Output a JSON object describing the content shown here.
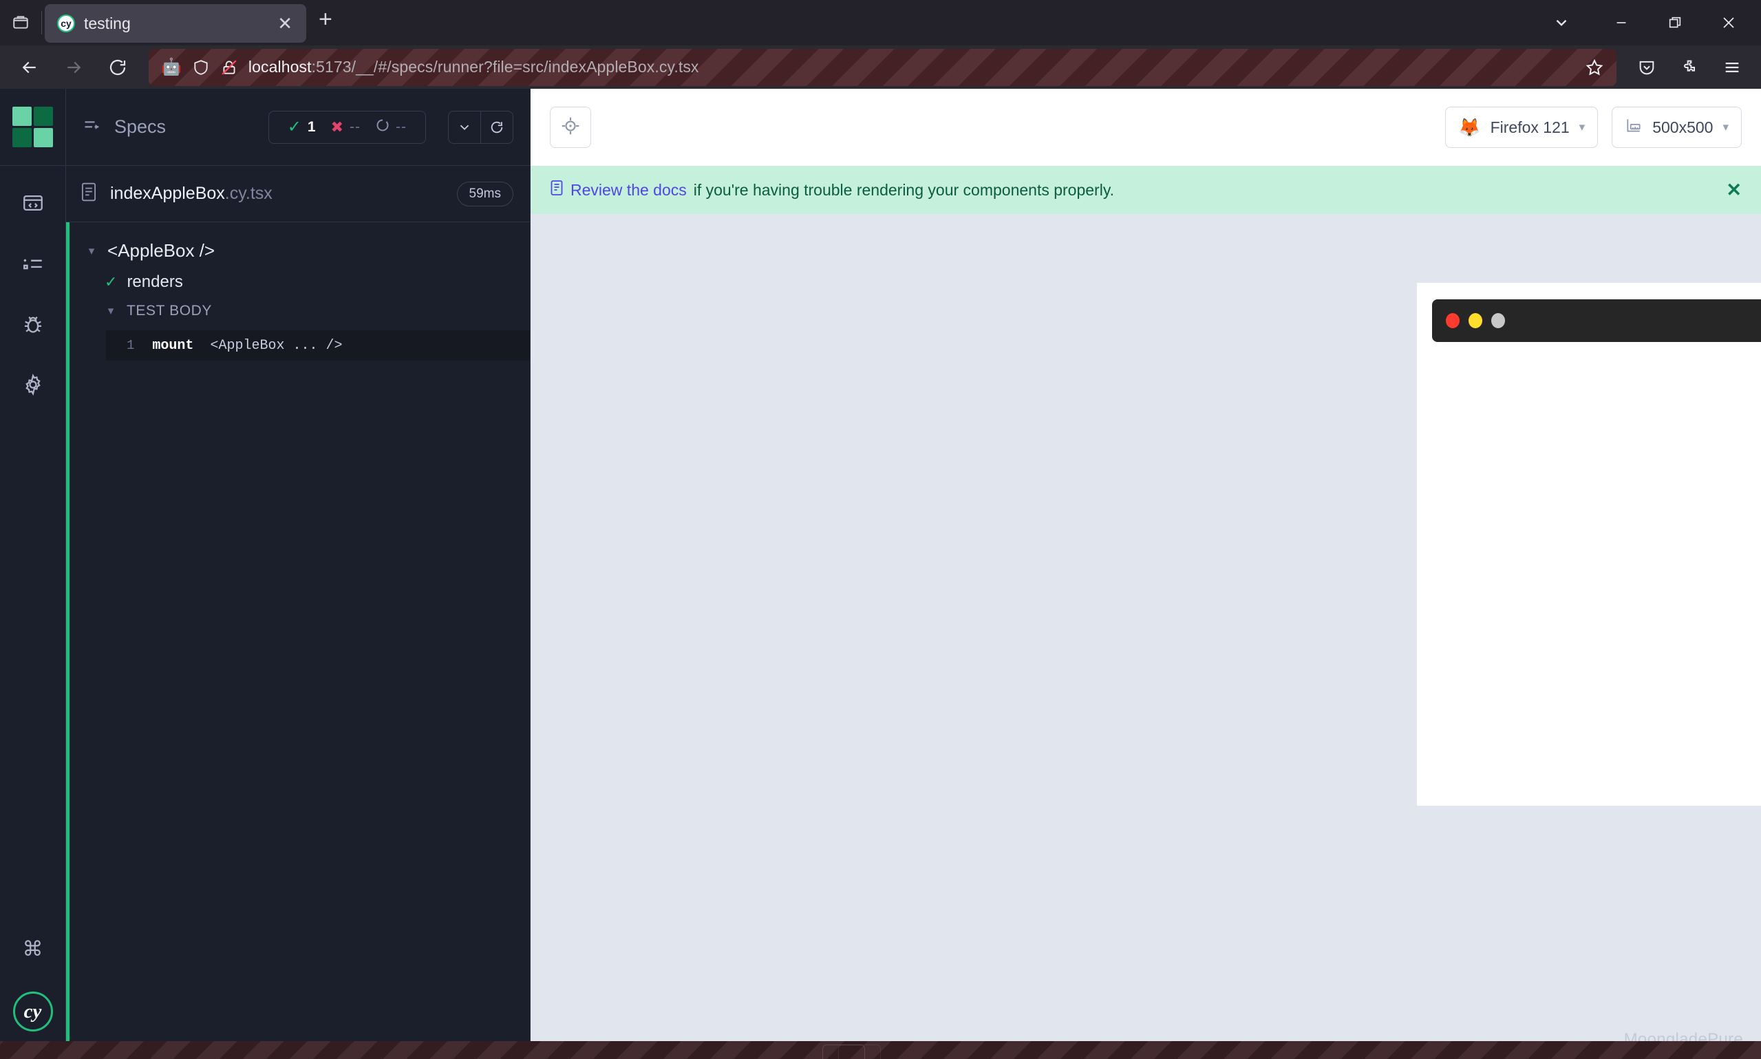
{
  "browser": {
    "tab": {
      "title": "testing",
      "favicon_icon": "cypress-favicon",
      "close_icon": "close-icon"
    },
    "new_tab_icon": "plus-icon",
    "tab_list_icon": "tab-list-icon",
    "list_all_tabs_icon": "chevron-down-icon",
    "window_controls": {
      "minimize": "minimize-icon",
      "restore": "restore-icon",
      "close": "close-icon"
    },
    "nav": {
      "back_icon": "back-arrow-icon",
      "forward_icon": "forward-arrow-icon",
      "reload_icon": "reload-icon"
    },
    "urlbar": {
      "robot_icon": "robot-icon",
      "shield_icon": "shield-icon",
      "insecure_icon": "lock-crossed-icon",
      "host": "localhost",
      "rest": ":5173/__/#/specs/runner?file=src/indexAppleBox.cy.tsx",
      "full_url": "localhost:5173/__/#/specs/runner?file=src/indexAppleBox.cy.tsx",
      "bookmark_icon": "star-icon"
    },
    "toolbar_icons": [
      "pocket-save-icon",
      "extensions-puzzle-icon",
      "app-menu-hamburger-icon"
    ]
  },
  "cypress": {
    "rail": {
      "logo_icon": "cypress-squares-logo",
      "logo_colors": [
        "#69d3a7",
        "#0d6b43",
        "#0d6b43",
        "#69d3a7"
      ],
      "items": [
        {
          "name": "specs",
          "icon": "code-window-icon"
        },
        {
          "name": "runs",
          "icon": "list-x-icon"
        },
        {
          "name": "debug",
          "icon": "bug-icon"
        },
        {
          "name": "settings",
          "icon": "gear-icon"
        }
      ],
      "bottom": [
        {
          "name": "keyboard-shortcuts",
          "icon": "command-key-icon",
          "glyph": "⌘"
        },
        {
          "name": "cypress-badge",
          "icon": "cy-logo-icon",
          "label": "cy"
        }
      ]
    },
    "specs_panel": {
      "header_icon": "specs-arrow-icon",
      "title": "Specs",
      "stats": [
        {
          "name": "passed",
          "icon": "check-icon",
          "value": "1",
          "color": "#1fbf7e"
        },
        {
          "name": "failed",
          "icon": "x-icon",
          "value": "--",
          "color": "#e4436c"
        },
        {
          "name": "pending",
          "icon": "circle-dashed-icon",
          "value": "--",
          "color": "#8b93ad"
        }
      ],
      "controls": [
        {
          "name": "collapse-all",
          "icon": "chevron-down-icon"
        },
        {
          "name": "rerun",
          "icon": "reload-icon"
        }
      ],
      "spec_file": {
        "icon": "file-icon",
        "name": "indexAppleBox",
        "extension": ".cy.tsx",
        "duration": "59ms"
      },
      "tree": {
        "suite": {
          "label": "<AppleBox />",
          "expanded": true
        },
        "test": {
          "label": "renders",
          "status_icon": "check-icon",
          "passed": true
        },
        "test_body": {
          "label": "TEST BODY",
          "expanded": true,
          "commands": [
            {
              "number": "1",
              "name": "mount",
              "args": "<AppleBox ... />"
            }
          ]
        }
      }
    },
    "runner": {
      "selector_playground_icon": "crosshair-target-icon",
      "browser_selector": {
        "icon": "firefox-icon",
        "label": "Firefox 121",
        "chevron": "chevron-down-icon"
      },
      "viewport_selector": {
        "icon": "ruler-icon",
        "label": "500x500",
        "chevron": "chevron-down-icon"
      },
      "banner": {
        "icon": "book-docs-icon",
        "link_text": "Review the docs",
        "rest_text": " if you're having trouble rendering your components properly.",
        "close_icon": "close-icon",
        "background": "#c5f0dc"
      },
      "aut": {
        "window_dots": [
          {
            "name": "close-dot",
            "color": "#ff3b30"
          },
          {
            "name": "minimize-dot",
            "color": "#ffdd2d"
          },
          {
            "name": "zoom-dot",
            "color": "#c8c8c8"
          }
        ],
        "background": "#ffffff"
      },
      "watermark": "MoongladePure"
    }
  }
}
